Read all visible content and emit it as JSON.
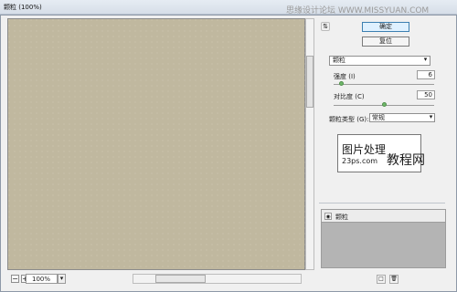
{
  "window": {
    "title": "颗粒 (100%)"
  },
  "watermark": "思缘设计论坛 WWW.MISSYUAN.COM",
  "preview": {
    "zoom": "100%",
    "zoom_out_icon": "minus-icon",
    "zoom_in_icon": "plus-icon"
  },
  "buttons": {
    "ok": "确定",
    "reset": "复位"
  },
  "filter": {
    "name": "颗粒"
  },
  "params": {
    "intensity": {
      "label": "强度 (I)",
      "value": "6",
      "level": 0.06
    },
    "contrast": {
      "label": "对比度 (C)",
      "value": "50",
      "level": 0.5
    },
    "grain_type": {
      "label": "颗粒类型 (G):",
      "value": "常规"
    }
  },
  "logo": {
    "line1": "图片处理",
    "line2": "23ps.com",
    "mark": "教程网"
  },
  "layers": [
    {
      "name": "颗粒",
      "visible": true
    }
  ],
  "colors": {
    "preview_bg": "#c0b89f",
    "primary_button": "#dff1ff",
    "slider_thumb": "#6fb86a"
  },
  "icons": {
    "collapse": "collapse-icon",
    "eye": "eye-icon",
    "new_layer": "new-layer-icon",
    "delete_layer": "delete-icon"
  }
}
